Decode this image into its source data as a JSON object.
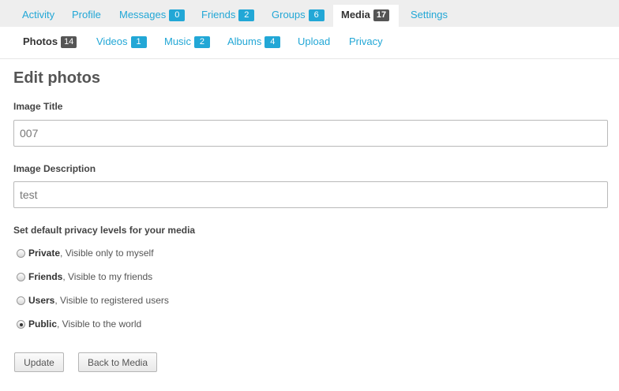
{
  "topnav": [
    {
      "label": "Activity",
      "count": null,
      "active": false
    },
    {
      "label": "Profile",
      "count": null,
      "active": false
    },
    {
      "label": "Messages",
      "count": "0",
      "active": false
    },
    {
      "label": "Friends",
      "count": "2",
      "active": false
    },
    {
      "label": "Groups",
      "count": "6",
      "active": false
    },
    {
      "label": "Media",
      "count": "17",
      "active": true
    },
    {
      "label": "Settings",
      "count": null,
      "active": false
    }
  ],
  "subnav": [
    {
      "label": "Photos",
      "count": "14",
      "active": true
    },
    {
      "label": "Videos",
      "count": "1",
      "active": false
    },
    {
      "label": "Music",
      "count": "2",
      "active": false
    },
    {
      "label": "Albums",
      "count": "4",
      "active": false
    },
    {
      "label": "Upload",
      "count": null,
      "active": false
    },
    {
      "label": "Privacy",
      "count": null,
      "active": false
    }
  ],
  "page_title": "Edit photos",
  "form": {
    "title_label": "Image Title",
    "title_value": "007",
    "description_label": "Image Description",
    "description_value": "test",
    "privacy_label": "Set default privacy levels for your media",
    "privacy_options": [
      {
        "name": "Private",
        "desc": ", Visible only to myself",
        "checked": false
      },
      {
        "name": "Friends",
        "desc": ", Visible to my friends",
        "checked": false
      },
      {
        "name": "Users",
        "desc": ", Visible to registered users",
        "checked": false
      },
      {
        "name": "Public",
        "desc": ", Visible to the world",
        "checked": true
      }
    ],
    "update_label": "Update",
    "back_label": "Back to Media"
  },
  "colors": {
    "accent": "#22a7d6",
    "count_dark": "#555555",
    "nav_bg": "#eeeeee"
  }
}
